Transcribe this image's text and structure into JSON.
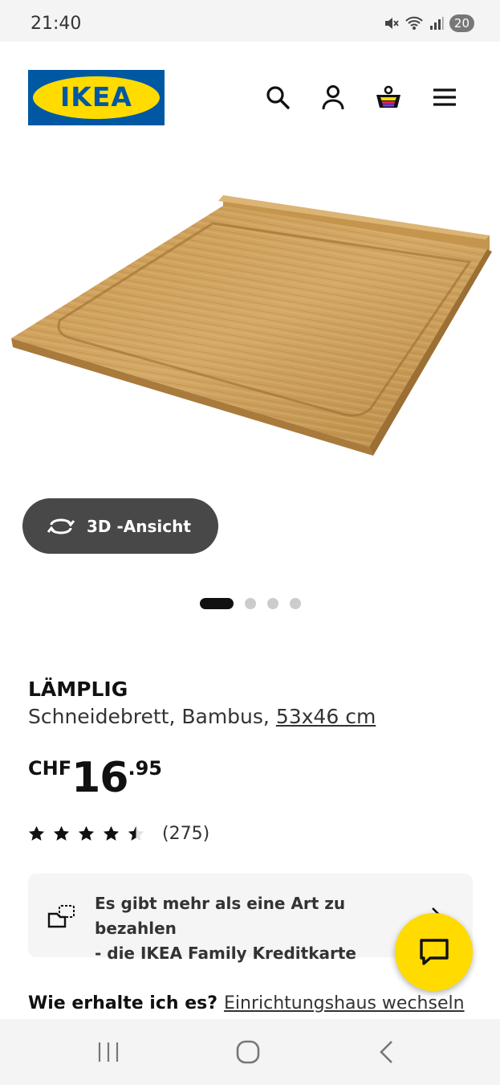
{
  "status_bar": {
    "time": "21:40",
    "battery": "20"
  },
  "header": {
    "logo_text": "IKEA"
  },
  "gallery": {
    "view_3d_label": "3D -Ansicht",
    "dot_count": 4,
    "active_index": 0
  },
  "product": {
    "name": "LÄMPLIG",
    "description": "Schneidebrett, Bambus,",
    "size": "53x46 cm",
    "price": {
      "currency": "CHF",
      "integer": "16",
      "decimal": ".95"
    },
    "rating": {
      "stars": 4.5,
      "count": "(275)"
    }
  },
  "payment_banner": {
    "line1": "Es gibt mehr als eine Art zu bezahlen",
    "line2": "- die IKEA Family Kreditkarte"
  },
  "delivery": {
    "question": "Wie erhalte ich es?",
    "change_store_link": "Einrichtungshaus wechseln"
  },
  "colors": {
    "brand_blue": "#0058a3",
    "brand_yellow": "#ffdb00",
    "wood": "#c89a4e"
  }
}
